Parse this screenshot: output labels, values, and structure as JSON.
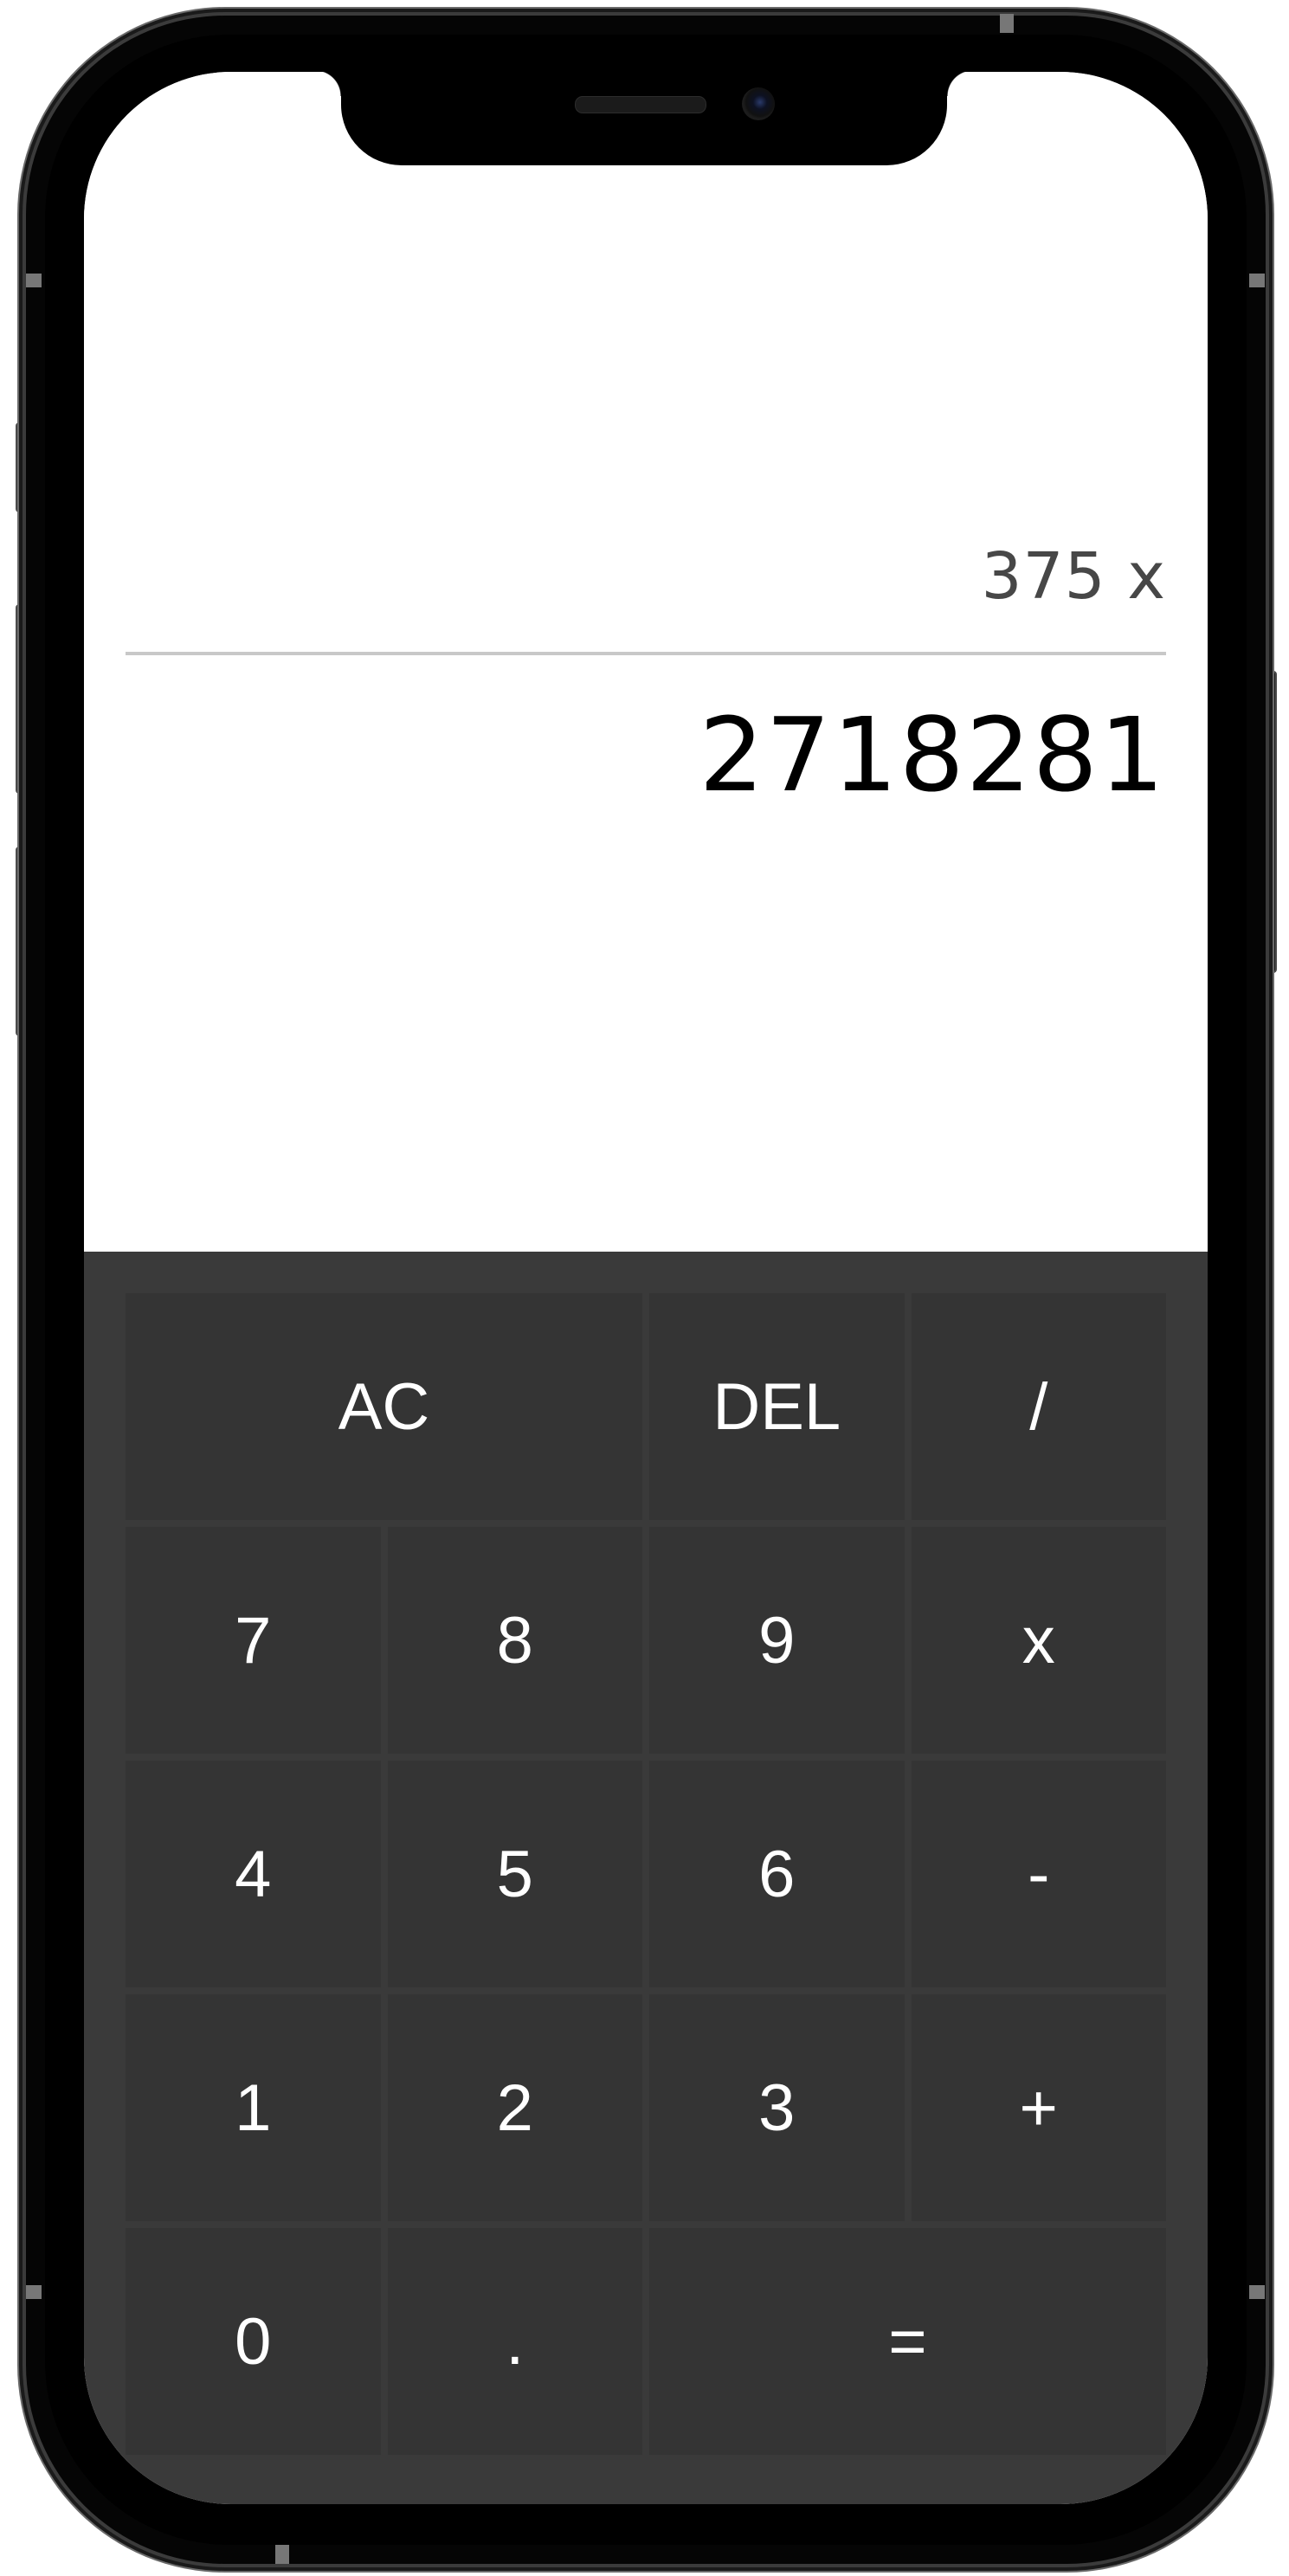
{
  "display": {
    "previous_operand": "375 x",
    "current_operand": "2718281"
  },
  "keys": {
    "all_clear": "AC",
    "delete": "DEL",
    "divide": "/",
    "seven": "7",
    "eight": "8",
    "nine": "9",
    "multiply": "x",
    "four": "4",
    "five": "5",
    "six": "6",
    "subtract": "-",
    "one": "1",
    "two": "2",
    "three": "3",
    "add": "+",
    "zero": "0",
    "decimal": ".",
    "equals": "="
  },
  "colors": {
    "keypad_background": "#3a3a3a",
    "key_background": "#343434",
    "key_text": "#ffffff",
    "display_background": "#ffffff",
    "previous_text": "#474747",
    "current_text": "#000000",
    "divider": "#c8c8c8"
  }
}
